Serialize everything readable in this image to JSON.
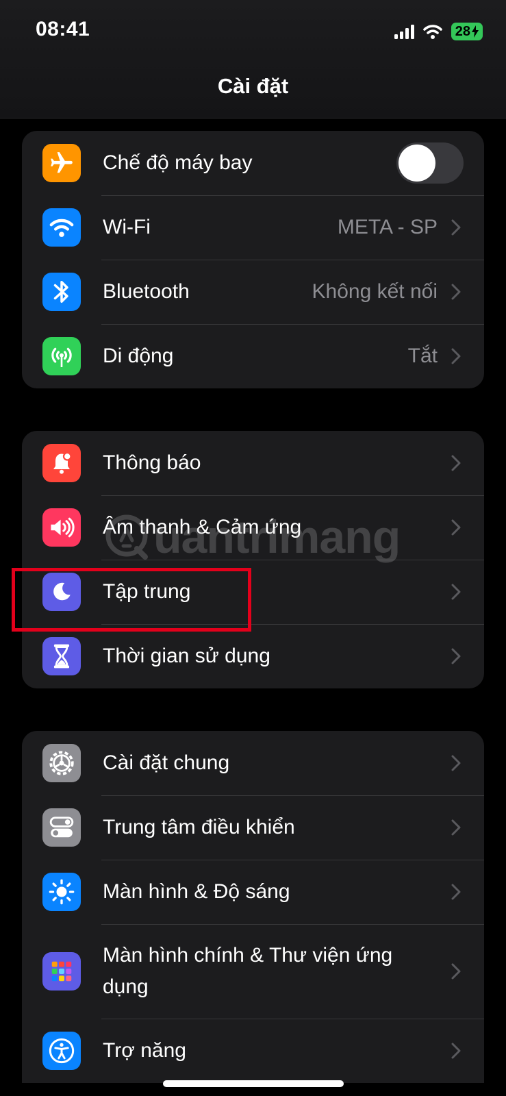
{
  "status": {
    "time": "08:41",
    "battery": "28"
  },
  "nav": {
    "title": "Cài đặt"
  },
  "groups": [
    {
      "rows": [
        {
          "label": "Chế độ máy bay",
          "icon": "airplane-icon",
          "color": "#ff9500",
          "toggle": false
        },
        {
          "label": "Wi-Fi",
          "value": "META - SP",
          "icon": "wifi-icon",
          "color": "#0a84ff"
        },
        {
          "label": "Bluetooth",
          "value": "Không kết nối",
          "icon": "bluetooth-icon",
          "color": "#0a84ff"
        },
        {
          "label": "Di động",
          "value": "Tắt",
          "icon": "cellular-antenna-icon",
          "color": "#30d158"
        }
      ]
    },
    {
      "rows": [
        {
          "label": "Thông báo",
          "icon": "notification-bell-icon",
          "color": "#ff453a"
        },
        {
          "label": "Âm thanh & Cảm ứng",
          "icon": "speaker-icon",
          "color": "#ff375f"
        },
        {
          "label": "Tập trung",
          "icon": "moon-icon",
          "color": "#5e5ce6",
          "highlighted": true
        },
        {
          "label": "Thời gian sử dụng",
          "icon": "hourglass-icon",
          "color": "#5e5ce6"
        }
      ]
    },
    {
      "rows": [
        {
          "label": "Cài đặt chung",
          "icon": "gear-icon",
          "color": "#8e8e93"
        },
        {
          "label": "Trung tâm điều khiển",
          "icon": "control-switches-icon",
          "color": "#8e8e93"
        },
        {
          "label": "Màn hình & Độ sáng",
          "icon": "sun-icon",
          "color": "#0a84ff"
        },
        {
          "label": "Màn hình chính & Thư viện ứng dụng",
          "icon": "app-grid-icon",
          "color": "#5e5ce6"
        },
        {
          "label": "Trợ năng",
          "icon": "accessibility-icon",
          "color": "#0a84ff"
        }
      ]
    }
  ],
  "watermark": {
    "text": "uantrimang"
  }
}
